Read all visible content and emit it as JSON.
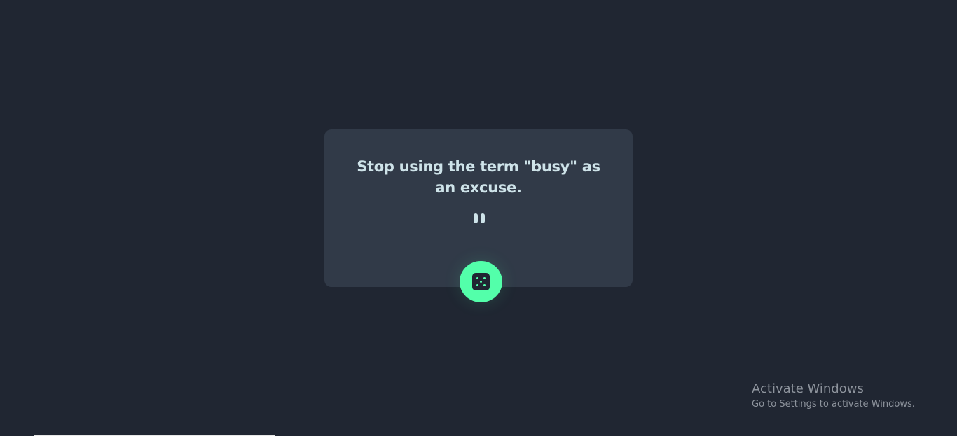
{
  "advice": {
    "quote": "Stop using the term \"busy\" as an excuse."
  },
  "divider": {
    "icon": "pause-icon"
  },
  "generate_button": {
    "icon": "dice-icon"
  },
  "watermark": {
    "title": "Activate Windows",
    "subtitle": "Go to Settings to activate Windows."
  },
  "colors": {
    "background": "#202632",
    "card": "#313a48",
    "text": "#cee3e9",
    "accent": "#53ffaa",
    "divider": "#4f5b69"
  }
}
